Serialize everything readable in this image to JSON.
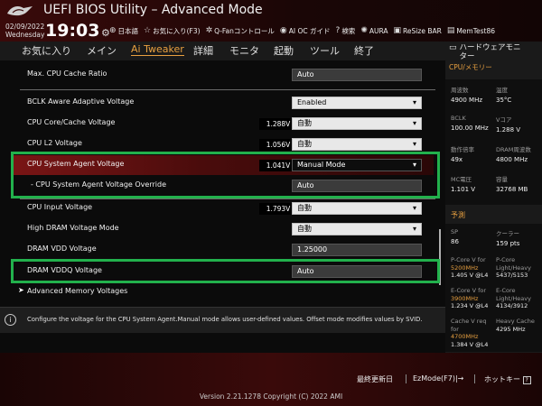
{
  "header": {
    "title": "UEFI BIOS Utility – Advanced Mode",
    "date": "02/09/2022",
    "weekday": "Wednesday",
    "time": "19:03",
    "toolbar": [
      {
        "icon": "globe-icon",
        "label": "日本語"
      },
      {
        "icon": "star-icon",
        "label": "お気に入り(F3)"
      },
      {
        "icon": "fan-icon",
        "label": "Q-Fanコントロール"
      },
      {
        "icon": "oc-icon",
        "label": "AI OC ガイド"
      },
      {
        "icon": "help-icon",
        "label": "検索"
      },
      {
        "icon": "aura-icon",
        "label": "AURA"
      },
      {
        "icon": "resize-bar-icon",
        "label": "ReSize BAR"
      },
      {
        "icon": "memtest-icon",
        "label": "MemTest86"
      }
    ]
  },
  "nav": {
    "tabs": [
      "お気に入り",
      "メイン",
      "Ai Tweaker",
      "詳細",
      "モニタ",
      "起動",
      "ツール",
      "終了"
    ],
    "active": "Ai Tweaker"
  },
  "settings": {
    "max_cpu_cache_ratio": {
      "label": "Max. CPU Cache Ratio",
      "value": "Auto"
    },
    "bclk_aware": {
      "label": "BCLK Aware Adaptive Voltage",
      "value": "Enabled"
    },
    "cpu_core_cache_voltage": {
      "label": "CPU Core/Cache Voltage",
      "current": "1.288V",
      "value": "自動"
    },
    "cpu_l2_voltage": {
      "label": "CPU L2 Voltage",
      "current": "1.056V",
      "value": "自動"
    },
    "cpu_sa_voltage": {
      "label": "CPU System Agent Voltage",
      "current": "1.041V",
      "value": "Manual Mode"
    },
    "cpu_sa_override": {
      "label": "- CPU System Agent Voltage Override",
      "value": "Auto"
    },
    "cpu_input_voltage": {
      "label": "CPU Input Voltage",
      "current": "1.793V",
      "value": "自動"
    },
    "high_dram_voltage_mode": {
      "label": "High DRAM Voltage Mode",
      "value": "自動"
    },
    "dram_vdd_voltage": {
      "label": "DRAM VDD Voltage",
      "value": "1.25000"
    },
    "dram_vddq_voltage": {
      "label": "DRAM VDDQ Voltage",
      "value": "Auto"
    },
    "advanced_memory_voltages": {
      "label": "Advanced Memory Voltages"
    }
  },
  "help": {
    "text": "Configure the voltage for the CPU System Agent.Manual mode allows user-defined values. Offset mode modifies values by SVID."
  },
  "hardware_monitor": {
    "title_line1": "ハードウェアモニ",
    "title_line2": "ター",
    "category": "CPU/メモリー",
    "cells": [
      {
        "label": "周波数",
        "value": "4900 MHz"
      },
      {
        "label": "温度",
        "value": "35°C"
      },
      {
        "label": "BCLK",
        "value": "100.00 MHz"
      },
      {
        "label": "Vコア",
        "value": "1.288 V"
      },
      {
        "label": "動作倍率",
        "value": "49x"
      },
      {
        "label": "DRAM周波数",
        "value": "4800 MHz"
      },
      {
        "label": "MC電圧",
        "value": "1.101 V"
      },
      {
        "label": "容量",
        "value": "32768 MB"
      }
    ],
    "prediction_label": "予測",
    "sp_label": "SP",
    "sp_value": "86",
    "cooler_label": "クーラー",
    "cooler_value": "159 pts",
    "pcore_label": "P-Core V for",
    "pcore_freq": "5200MHz",
    "pcore_value": "1.405 V @L4",
    "pcore_lh_label": "P-Core Light/Heavy",
    "pcore_lh_value": "5437/5153",
    "ecore_label": "E-Core V for",
    "ecore_freq": "3900MHz",
    "ecore_value": "1.234 V @L4",
    "ecore_lh_label": "E-Core Light/Heavy",
    "ecore_lh_value": "4134/3912",
    "cache_label": "Cache V req for",
    "cache_freq": "4700MHz",
    "cache_value": "1.384 V @L4",
    "heavy_cache_label": "Heavy Cache",
    "heavy_cache_value": "4295 MHz"
  },
  "footer": {
    "last_modified": "最終更新日",
    "ezmode": "EzMode(F7)|→",
    "hotkey": "ホットキー",
    "version": "Version 2.21.1278 Copyright (C) 2022 AMI"
  },
  "colors": {
    "accent": "#e8a040",
    "highlight_red": "#7a1515",
    "annotation_green": "#22b14c"
  }
}
